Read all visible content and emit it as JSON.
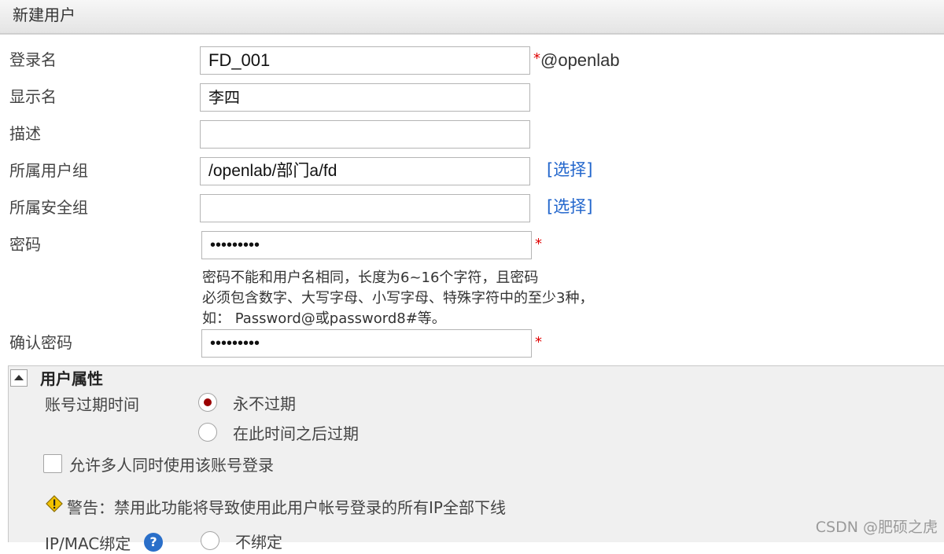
{
  "header": {
    "title": "新建用户"
  },
  "form": {
    "login_name": {
      "label": "登录名",
      "value": "FD_001",
      "required_mark": "*",
      "domain_suffix": "@openlab"
    },
    "display_name": {
      "label": "显示名",
      "value": "李四"
    },
    "description": {
      "label": "描述",
      "value": ""
    },
    "user_group": {
      "label": "所属用户组",
      "value": "/openlab/部门a/fd",
      "select_link": "[选择]"
    },
    "security_group": {
      "label": "所属安全组",
      "value": "",
      "select_link": "[选择]"
    },
    "password": {
      "label": "密码",
      "value": "•••••••••",
      "required_mark": "*"
    },
    "password_hint": [
      "密码不能和用户名相同，长度为6~16个字符，且密码",
      "必须包含数字、大写字母、小写字母、特殊字符中的至少3种，",
      "如： Password@或password8#等。"
    ],
    "confirm_password": {
      "label": "确认密码",
      "value": "•••••••••",
      "required_mark": "*"
    }
  },
  "user_attributes": {
    "title": "用户属性",
    "expiry_label": "账号过期时间",
    "expiry_options": [
      {
        "label": "永不过期",
        "checked": true
      },
      {
        "label": "在此时间之后过期",
        "checked": false
      }
    ],
    "multi_login_label": "允许多人同时使用该账号登录",
    "multi_login_checked": false,
    "warning_text": "警告：禁用此功能将导致使用此用户帐号登录的所有IP全部下线",
    "ipmac_label": "IP/MAC绑定",
    "ipmac_option": "不绑定"
  },
  "watermark": "CSDN @肥硕之虎",
  "colors": {
    "required": "#e00000",
    "link": "#2266cc",
    "radio_checked": "#9b0000"
  }
}
